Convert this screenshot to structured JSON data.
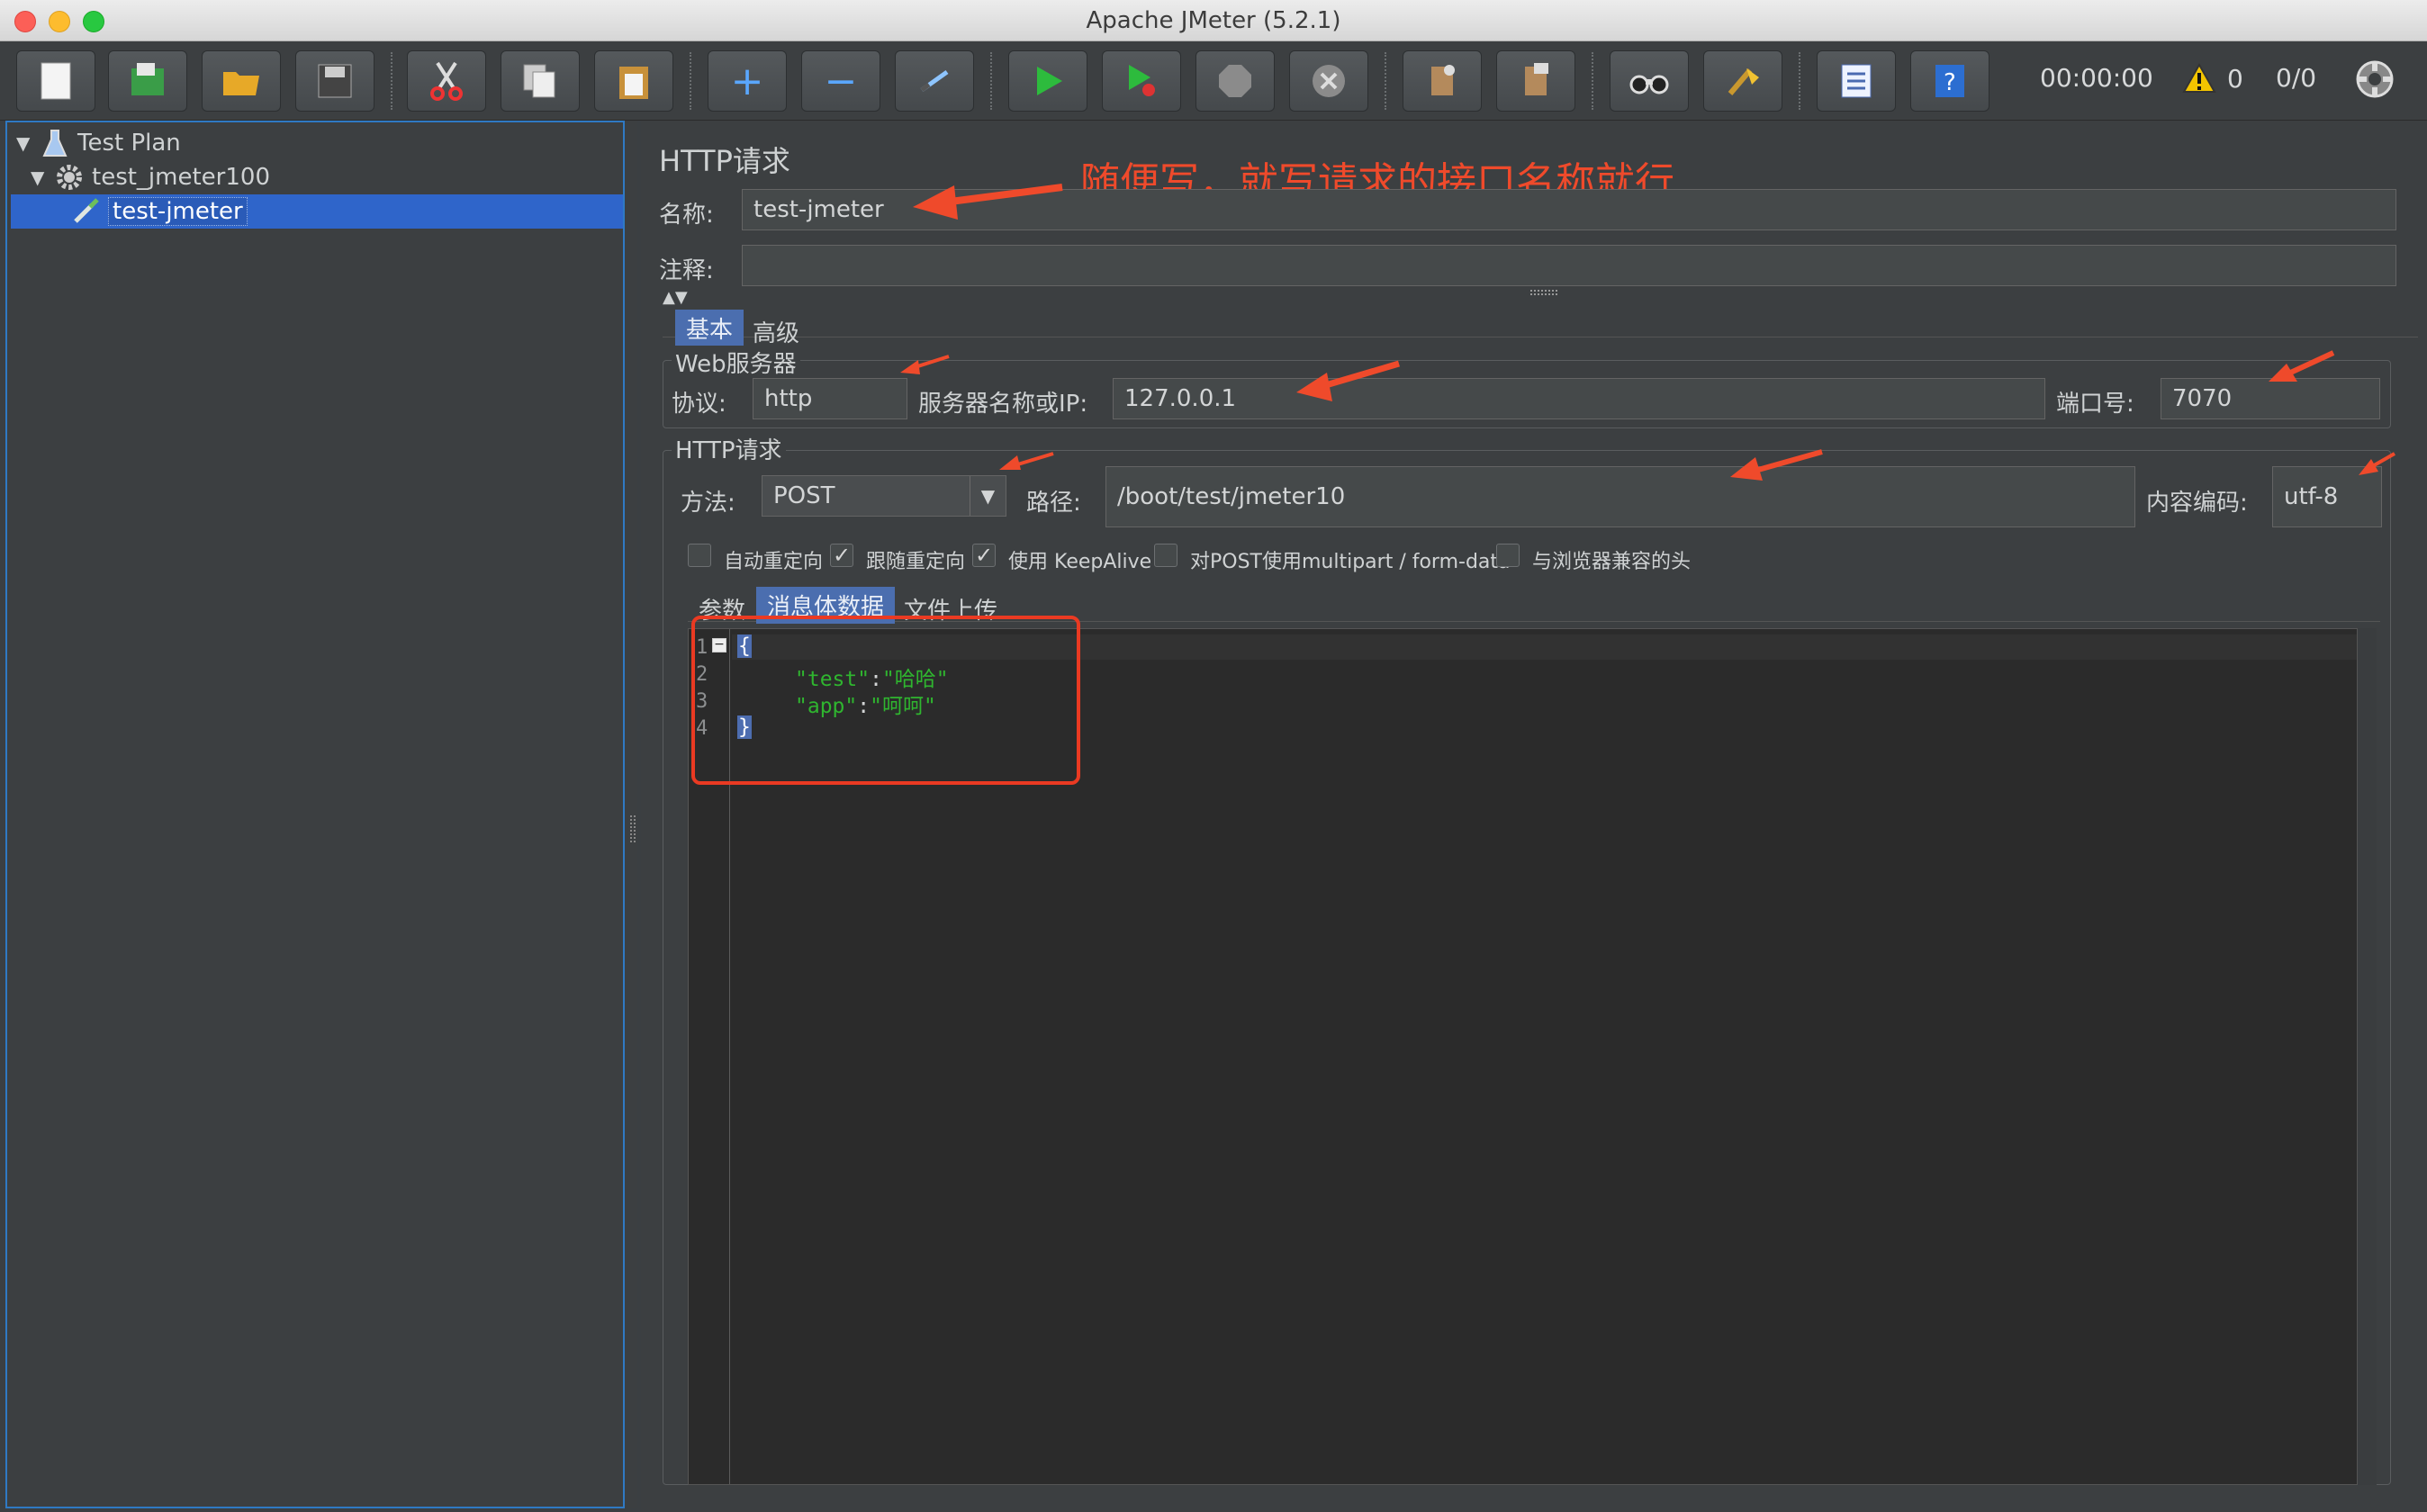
{
  "window": {
    "title": "Apache JMeter (5.2.1)"
  },
  "toolbar": {
    "buttons": [
      "new-icon",
      "templates-icon",
      "open-icon",
      "save-icon",
      "cut-icon",
      "copy-icon",
      "paste-icon",
      "expand-icon",
      "collapse-icon",
      "toggle-icon",
      "start-icon",
      "start-no-pause-icon",
      "stop-icon",
      "shutdown-icon",
      "clear-icon",
      "clear-all-icon",
      "search-icon",
      "reset-search-icon",
      "function-helper-icon",
      "help-icon"
    ],
    "elapsed": "00:00:00",
    "warnings": "0",
    "threads": "0/0"
  },
  "tree": {
    "items": [
      {
        "label": "Test Plan"
      },
      {
        "label": "test_jmeter100"
      },
      {
        "label": "test-jmeter"
      }
    ]
  },
  "panel": {
    "title": "HTTP请求",
    "name_label": "名称:",
    "name_value": "test-jmeter",
    "comment_label": "注释:",
    "comment_value": "",
    "annotation": "随便写，就写请求的接口名称就行",
    "tabs": [
      "基本",
      "高级"
    ],
    "web_server": {
      "title": "Web服务器",
      "protocol_label": "协议:",
      "protocol_value": "http",
      "server_label": "服务器名称或IP:",
      "server_value": "127.0.0.1",
      "port_label": "端口号:",
      "port_value": "7070"
    },
    "http_request": {
      "title": "HTTP请求",
      "method_label": "方法:",
      "method_value": "POST",
      "path_label": "路径:",
      "path_value": "/boot/test/jmeter10",
      "encoding_label": "内容编码:",
      "encoding_value": "utf-8"
    },
    "options": [
      {
        "label": "自动重定向",
        "checked": false
      },
      {
        "label": "跟随重定向",
        "checked": true
      },
      {
        "label": "使用 KeepAlive",
        "checked": true
      },
      {
        "label": "对POST使用multipart / form-data",
        "checked": false
      },
      {
        "label": "与浏览器兼容的头",
        "checked": false
      }
    ],
    "body_tabs": [
      "参数",
      "消息体数据",
      "文件上传"
    ],
    "editor": {
      "line_numbers": [
        "1",
        "2",
        "3",
        "4"
      ],
      "open_brace": "{",
      "line2_key": "\"test\"",
      "line2_value": "\"哈哈\"",
      "line3_key": "\"app\"",
      "line3_value": "\"呵呵\"",
      "close_brace": "}"
    },
    "colors": {
      "annotation": "#ef4a2b",
      "json_string": "#2fb52f",
      "selection": "#2f65ca"
    }
  }
}
